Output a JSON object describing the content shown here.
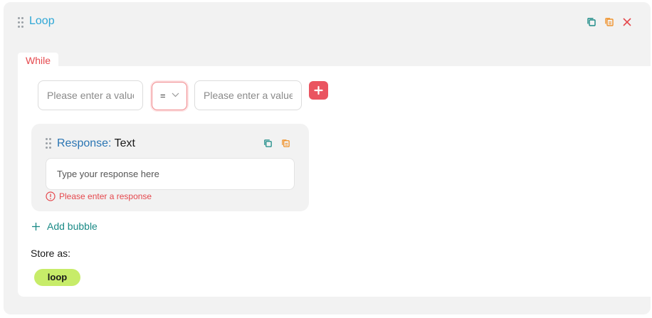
{
  "loop": {
    "title": "Loop",
    "icons": {
      "duplicate": "copy-icon",
      "copy": "clipboard-icon",
      "close": "close-icon"
    },
    "tab_label": "While",
    "condition": {
      "left_placeholder": "Please enter a value",
      "operator": "=",
      "right_placeholder": "Please enter a value",
      "add_icon": "plus-icon"
    },
    "response": {
      "label": "Response:",
      "type": "Text",
      "placeholder": "Type your response here",
      "error": "Please enter a response"
    },
    "add_bubble_label": "Add bubble",
    "store_as_label": "Store as:",
    "store_as_value": "loop"
  },
  "colors": {
    "title": "#2fa7d6",
    "error": "#e5484d",
    "accent_teal": "#1a8a86",
    "chip": "#c7ec69"
  }
}
